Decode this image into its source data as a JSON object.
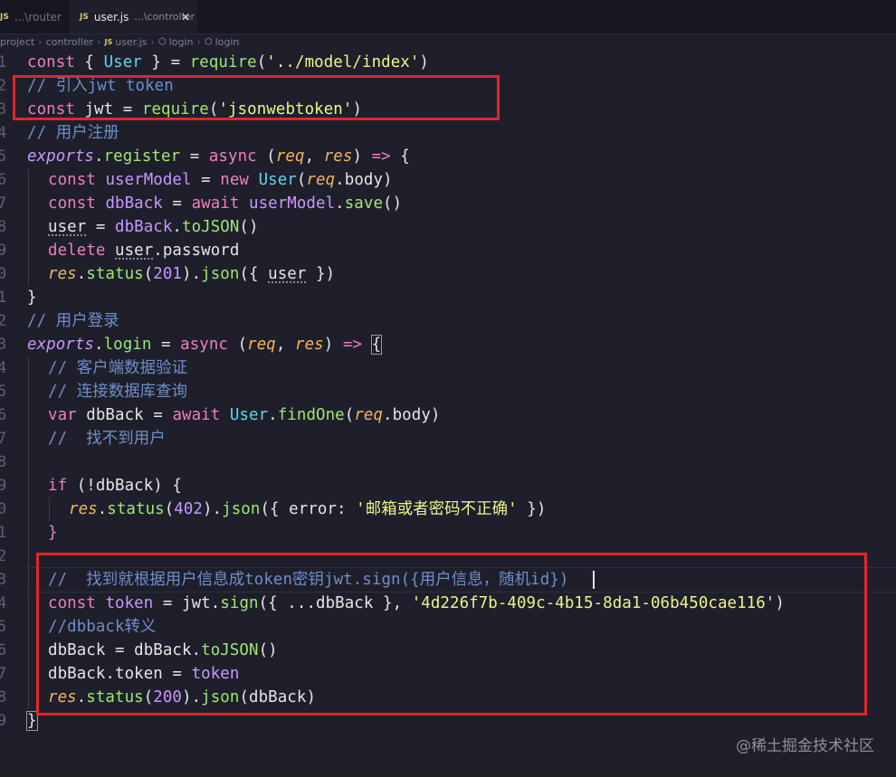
{
  "tabs": [
    {
      "badge": "JS",
      "label": "...\\router"
    },
    {
      "badge": "JS",
      "label": "user.js",
      "path": "...\\controller",
      "close": "✕"
    }
  ],
  "breadcrumb": [
    "project",
    "controller",
    "user.js",
    "login",
    "login"
  ],
  "line_numbers": [
    "1",
    "2",
    "3",
    "4",
    "5",
    "6",
    "7",
    "8",
    "9",
    "0",
    "1",
    "2",
    "3",
    "4",
    "5",
    "6",
    "7",
    "8",
    "9",
    "0",
    "1",
    "2",
    "3",
    "4",
    "5",
    "6",
    "7",
    "8",
    "9"
  ],
  "code": {
    "l1": [
      "const",
      "User",
      "require",
      "'../model/index'"
    ],
    "l2": "// 引入jwt token",
    "l3": [
      "const",
      "jwt",
      "require",
      "'jsonwebtoken'"
    ],
    "l4": "// 用户注册",
    "l5": [
      "exports",
      "register",
      "async",
      "req",
      "res"
    ],
    "l6": [
      "const",
      "userModel",
      "new",
      "User",
      "req",
      "body"
    ],
    "l7": [
      "const",
      "dbBack",
      "await",
      "userModel",
      "save"
    ],
    "l8": [
      "user",
      "dbBack",
      "toJSON"
    ],
    "l9": [
      "delete",
      "user",
      "password"
    ],
    "l10": [
      "res",
      "status",
      "201",
      "json",
      "user"
    ],
    "l12": "// 用户登录",
    "l13": [
      "exports",
      "login",
      "async",
      "req",
      "res"
    ],
    "l14": "// 客户端数据验证",
    "l15": "// 连接数据库查询",
    "l16": [
      "var",
      "dbBack",
      "await",
      "User",
      "findOne",
      "req",
      "body"
    ],
    "l17": "//  找不到用户",
    "l19": [
      "if",
      "dbBack"
    ],
    "l20": [
      "res",
      "status",
      "402",
      "json",
      "error",
      "'邮箱或者密码不正确'"
    ],
    "l23": "//  找到就根据用户信息成token密钥jwt.sign({用户信息，随机id})",
    "l24": [
      "const",
      "token",
      "jwt",
      "sign",
      "dbBack",
      "'4d226f7b-409c-4b15-8da1-06b450cae116'"
    ],
    "l25": "//dbback转义",
    "l26": [
      "dbBack",
      "dbBack",
      "toJSON"
    ],
    "l27": [
      "dbBack",
      "token",
      "token"
    ],
    "l28": [
      "res",
      "status",
      "200",
      "json",
      "dbBack"
    ]
  },
  "watermark": "@稀土掘金技术社区",
  "colors": {
    "highlight_box": "#e0262a",
    "background": "#1e1f2b"
  }
}
